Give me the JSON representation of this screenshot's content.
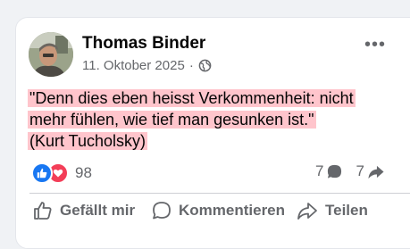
{
  "post": {
    "author": "Thomas Binder",
    "date": "11. Oktober 2025",
    "separator": "·",
    "audience_icon": "globe-icon",
    "more_icon": "more-options-icon",
    "more_label": "•••",
    "text_line1": "\"Denn dies eben heisst Verkommenheit: nicht",
    "text_line2": "mehr fühlen, wie tief man gesunken ist.\"",
    "text_line3": "(Kurt Tucholsky)",
    "highlight_color": "#ffc5cc"
  },
  "reactions": {
    "icons": [
      "like-reaction-icon",
      "love-reaction-icon"
    ],
    "count": "98",
    "comments_count": "7",
    "shares_count": "7"
  },
  "actions": {
    "like_label": "Gefällt mir",
    "comment_label": "Kommentieren",
    "share_label": "Teilen"
  },
  "colors": {
    "like_blue": "#1877f2",
    "love_red": "#f33e58",
    "secondary_text": "#65676b"
  }
}
